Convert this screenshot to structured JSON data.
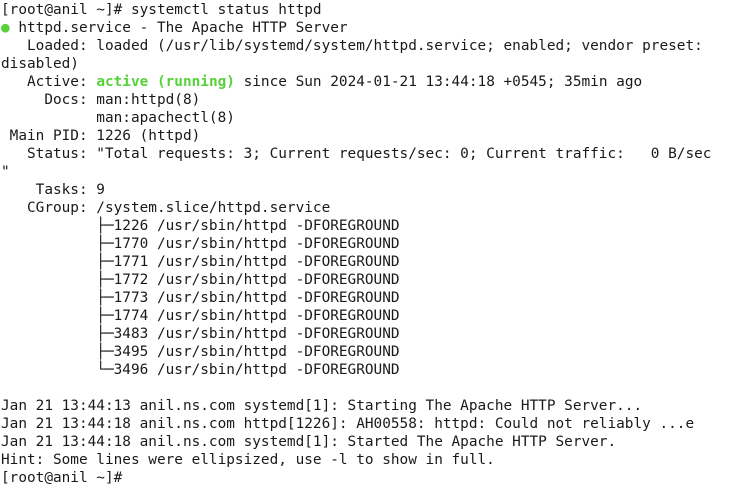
{
  "prompt": "[root@anil ~]# ",
  "command": "systemctl status httpd",
  "status_dot": "●",
  "service_header": " httpd.service - The Apache HTTP Server",
  "loaded_line_1": "   Loaded: loaded (/usr/lib/systemd/system/httpd.service; enabled; vendor preset:",
  "loaded_line_2": "disabled)",
  "active_label": "   Active: ",
  "active_state": "active (running)",
  "active_since": " since Sun 2024-01-21 13:44:18 +0545; 35min ago",
  "docs_line_1": "     Docs: man:httpd(8)",
  "docs_line_2": "           man:apachectl(8)",
  "main_pid": " Main PID: 1226 (httpd)",
  "status_line_1": "   Status: \"Total requests: 3; Current requests/sec: 0; Current traffic:   0 B/sec",
  "status_line_2": "\"",
  "tasks": "    Tasks: 9",
  "cgroup": "   CGroup: /system.slice/httpd.service",
  "cgroup_processes": [
    "           ├─1226 /usr/sbin/httpd -DFOREGROUND",
    "           ├─1770 /usr/sbin/httpd -DFOREGROUND",
    "           ├─1771 /usr/sbin/httpd -DFOREGROUND",
    "           ├─1772 /usr/sbin/httpd -DFOREGROUND",
    "           ├─1773 /usr/sbin/httpd -DFOREGROUND",
    "           ├─1774 /usr/sbin/httpd -DFOREGROUND",
    "           ├─3483 /usr/sbin/httpd -DFOREGROUND",
    "           ├─3495 /usr/sbin/httpd -DFOREGROUND",
    "           └─3496 /usr/sbin/httpd -DFOREGROUND"
  ],
  "journal": [
    "Jan 21 13:44:13 anil.ns.com systemd[1]: Starting The Apache HTTP Server...",
    "Jan 21 13:44:18 anil.ns.com httpd[1226]: AH00558: httpd: Could not reliably ...e",
    "Jan 21 13:44:18 anil.ns.com systemd[1]: Started The Apache HTTP Server.",
    "Hint: Some lines were ellipsized, use -l to show in full."
  ],
  "final_prompt": "[root@anil ~]# ",
  "colors": {
    "background": "#ffffff",
    "text": "#1a1a1a",
    "active_green": "#57d13b"
  }
}
